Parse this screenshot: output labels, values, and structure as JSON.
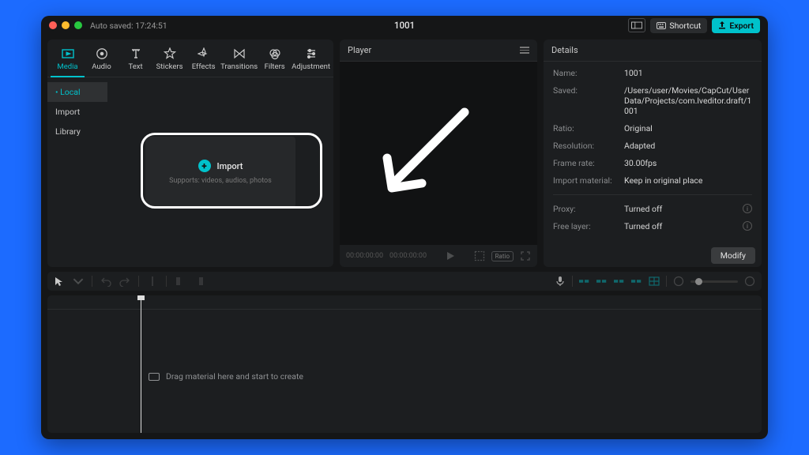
{
  "titlebar": {
    "autosave": "Auto saved: 17:24:51",
    "title": "1001",
    "shortcut": "Shortcut",
    "export": "Export"
  },
  "tool_tabs": [
    {
      "label": "Media",
      "icon": "media"
    },
    {
      "label": "Audio",
      "icon": "audio"
    },
    {
      "label": "Text",
      "icon": "text"
    },
    {
      "label": "Stickers",
      "icon": "stickers"
    },
    {
      "label": "Effects",
      "icon": "effects"
    },
    {
      "label": "Transitions",
      "icon": "transitions"
    },
    {
      "label": "Filters",
      "icon": "filters"
    },
    {
      "label": "Adjustment",
      "icon": "adjustment"
    }
  ],
  "side": {
    "items": [
      "Local",
      "Import",
      "Library"
    ],
    "active": 0
  },
  "import": {
    "label": "Import",
    "hint": "Supports: videos, audios, photos"
  },
  "player": {
    "title": "Player",
    "tc1": "00:00:00:00",
    "tc2": "00:00:00:00",
    "ratio_label": "Ratio"
  },
  "details": {
    "title": "Details",
    "rows": [
      {
        "k": "Name:",
        "v": "1001"
      },
      {
        "k": "Saved:",
        "v": "/Users/user/Movies/CapCut/User Data/Projects/com.lveditor.draft/1001"
      },
      {
        "k": "Ratio:",
        "v": "Original"
      },
      {
        "k": "Resolution:",
        "v": "Adapted"
      },
      {
        "k": "Frame rate:",
        "v": "30.00fps"
      },
      {
        "k": "Import material:",
        "v": "Keep in original place"
      }
    ],
    "rows2": [
      {
        "k": "Proxy:",
        "v": "Turned off"
      },
      {
        "k": "Free layer:",
        "v": "Turned off"
      }
    ],
    "modify": "Modify"
  },
  "timeline": {
    "placeholder": "Drag material here and start to create"
  }
}
